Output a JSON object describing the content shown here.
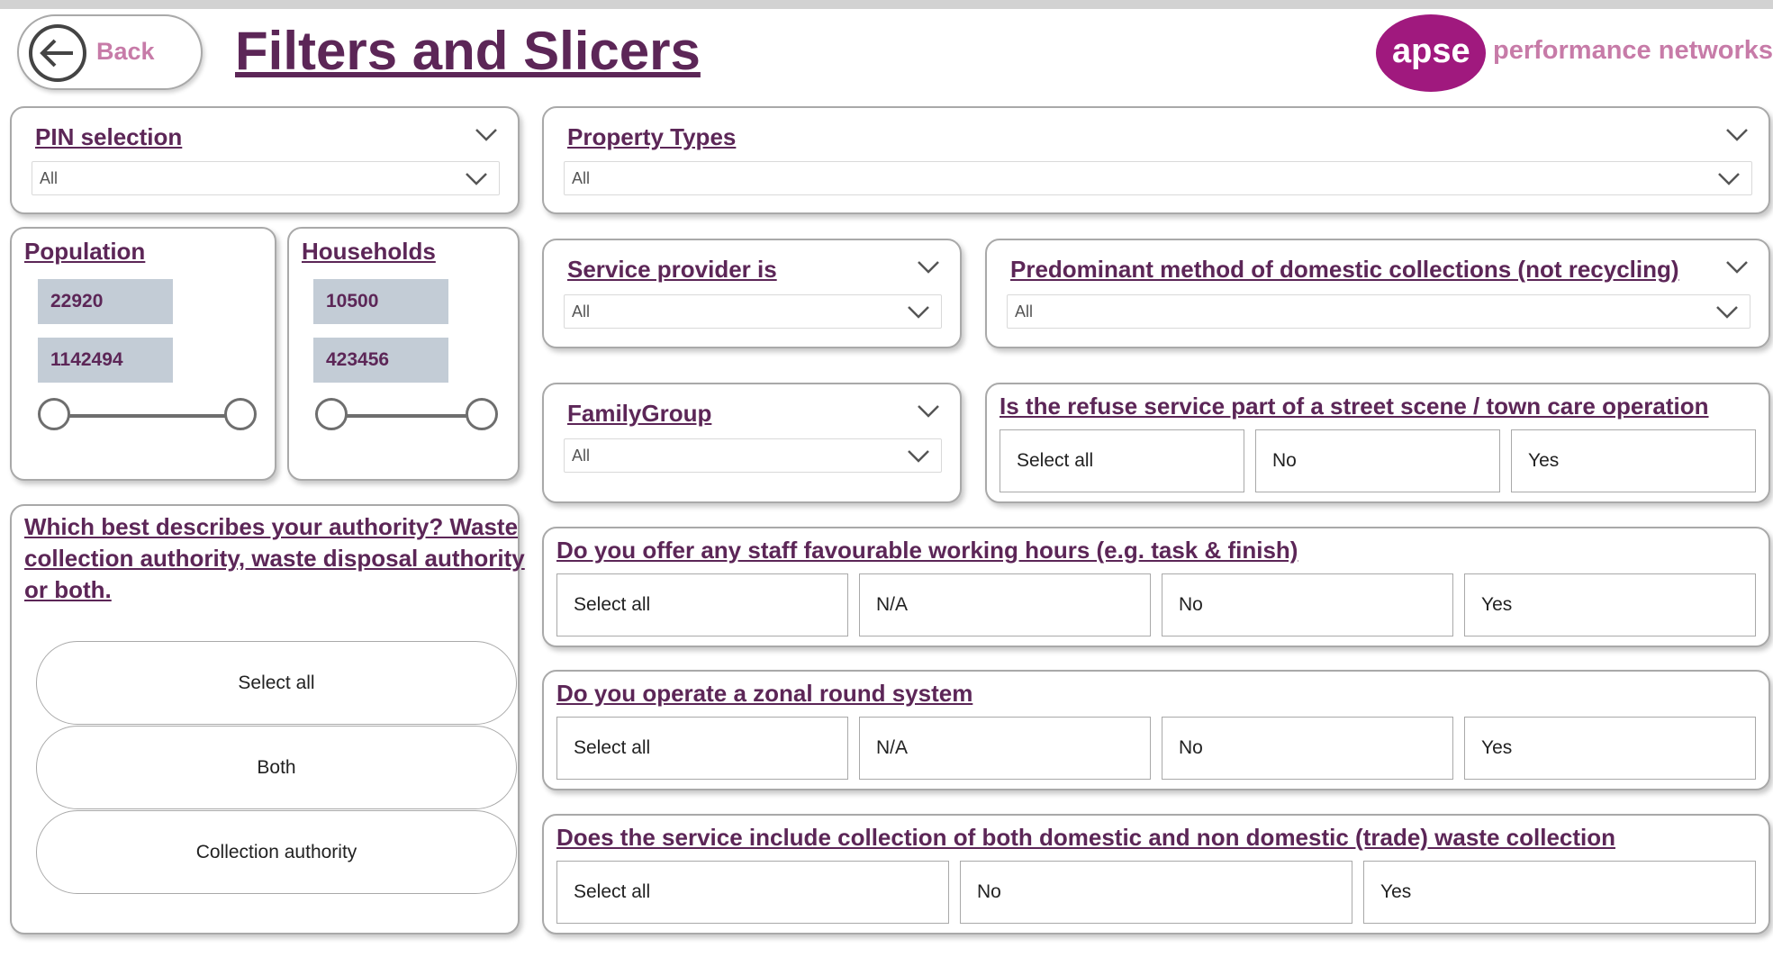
{
  "header": {
    "back_label": "Back",
    "title": "Filters and Slicers",
    "logo_badge": "apse",
    "logo_text": "performance networks"
  },
  "pin": {
    "title": "PIN selection",
    "value": "All"
  },
  "property_types": {
    "title": "Property Types",
    "value": "All"
  },
  "population": {
    "title": "Population",
    "min": "22920",
    "max": "1142494"
  },
  "households": {
    "title": "Households",
    "min": "10500",
    "max": "423456"
  },
  "service_provider": {
    "title": "Service provider is",
    "value": "All"
  },
  "predominant_method": {
    "title": "Predominant method of domestic collections (not recycling)",
    "value": "All"
  },
  "family_group": {
    "title": "FamilyGroup",
    "value": "All"
  },
  "refuse_service": {
    "title": "Is the refuse service part of a street scene / town care operation",
    "options": [
      "Select all",
      "No",
      "Yes"
    ]
  },
  "authority": {
    "title_line1": "Which best describes your authority? Waste",
    "title_line2": "collection authority, waste disposal authority",
    "title_line3": "or both.",
    "options": [
      "Select all",
      "Both",
      "Collection authority"
    ]
  },
  "working_hours": {
    "title": "Do you offer any staff favourable working hours (e.g. task & finish)",
    "options": [
      "Select all",
      "N/A",
      "No",
      "Yes"
    ]
  },
  "zonal_round": {
    "title": "Do you operate a zonal round system",
    "options": [
      "Select all",
      "N/A",
      "No",
      "Yes"
    ]
  },
  "trade_waste": {
    "title": "Does the service include collection of both domestic and non domestic (trade) waste collection",
    "options": [
      "Select all",
      "No",
      "Yes"
    ]
  },
  "colors": {
    "title_purple": "#5c2657",
    "brand_magenta": "#a0197e",
    "box_gray_blue": "#c3ccd6",
    "border_gray": "#a9a9a9"
  }
}
